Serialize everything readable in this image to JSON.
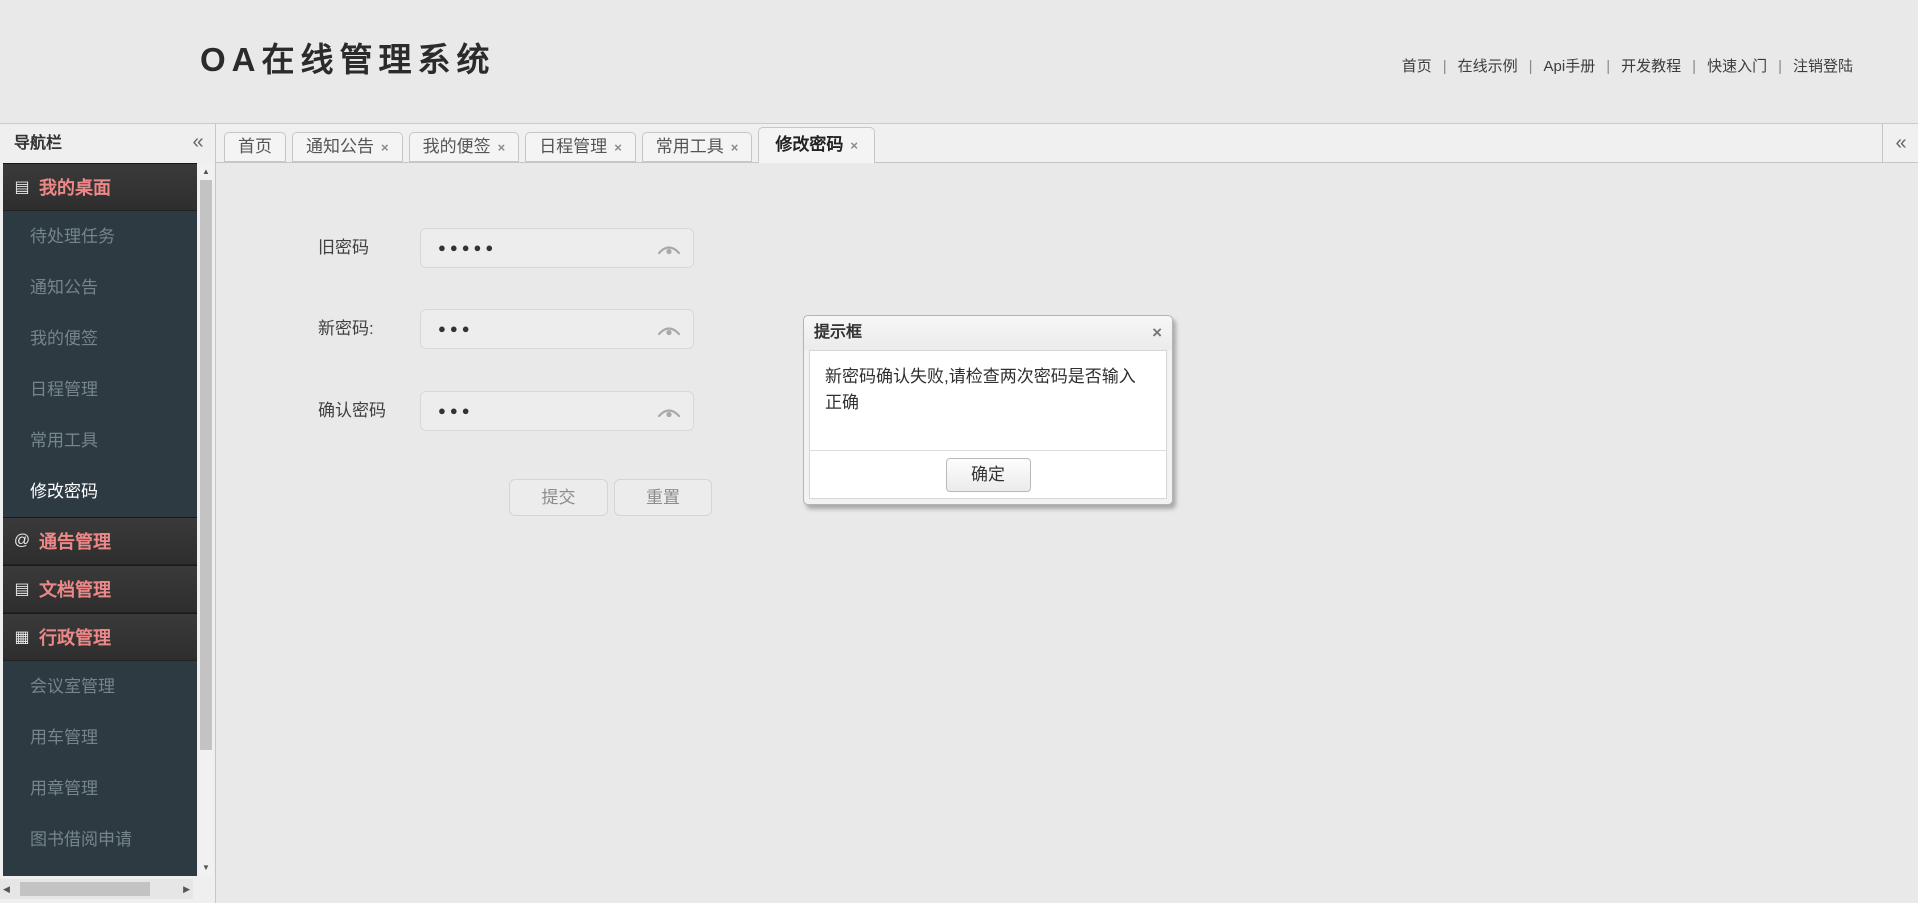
{
  "header": {
    "logo": "OA在线管理系统",
    "nav_separator": "|",
    "nav_links": [
      "首页",
      "在线示例",
      "Api手册",
      "开发教程",
      "快速入门",
      "注销登陆"
    ]
  },
  "sidebar": {
    "title": "导航栏",
    "collapse_icon": "«",
    "menu": [
      {
        "type": "group",
        "icon": "▤",
        "label": "我的桌面"
      },
      {
        "type": "item",
        "label": "待处理任务"
      },
      {
        "type": "item",
        "label": "通知公告"
      },
      {
        "type": "item",
        "label": "我的便签"
      },
      {
        "type": "item",
        "label": "日程管理"
      },
      {
        "type": "item",
        "label": "常用工具"
      },
      {
        "type": "item",
        "label": "修改密码",
        "active": true
      },
      {
        "type": "group",
        "icon": "@",
        "label": "通告管理"
      },
      {
        "type": "group",
        "icon": "▤",
        "label": "文档管理"
      },
      {
        "type": "group",
        "icon": "▦",
        "label": "行政管理"
      },
      {
        "type": "item",
        "label": "会议室管理"
      },
      {
        "type": "item",
        "label": "用车管理"
      },
      {
        "type": "item",
        "label": "用章管理"
      },
      {
        "type": "item",
        "label": "图书借阅申请"
      }
    ],
    "scrollbar_icons": {
      "up": "▲",
      "down": "▼",
      "left": "◀",
      "right": "▶"
    }
  },
  "tabs": {
    "close_icon": "×",
    "overflow_collapse_icon": "«",
    "items": [
      {
        "label": "首页",
        "closable": false
      },
      {
        "label": "通知公告",
        "closable": true
      },
      {
        "label": "我的便签",
        "closable": true
      },
      {
        "label": "日程管理",
        "closable": true
      },
      {
        "label": "常用工具",
        "closable": true
      },
      {
        "label": "修改密码",
        "closable": true,
        "active": true
      }
    ]
  },
  "form": {
    "fields": [
      {
        "label": "旧密码",
        "value": "●●●●●"
      },
      {
        "label": "新密码:",
        "value": "●●●"
      },
      {
        "label": "确认密码",
        "value": "●●●"
      }
    ],
    "submit_label": "提交",
    "reset_label": "重置"
  },
  "dialog": {
    "title": "提示框",
    "close_icon": "×",
    "message": "新密码确认失败,请检查两次密码是否输入正确",
    "ok_label": "确定"
  },
  "colors": {
    "page_bg": "#e9e9e9",
    "tab_strip_bg": "#f0f0f0",
    "sidebar_items_bg": "#2d3a42",
    "sidebar_group_bg": "#323232",
    "sidebar_group_text": "#ee8888",
    "sidebar_item_text": "#76848c",
    "sidebar_item_active_text": "#ffffff",
    "input_bg": "#ededed",
    "dialog_body_bg": "#ffffff"
  }
}
